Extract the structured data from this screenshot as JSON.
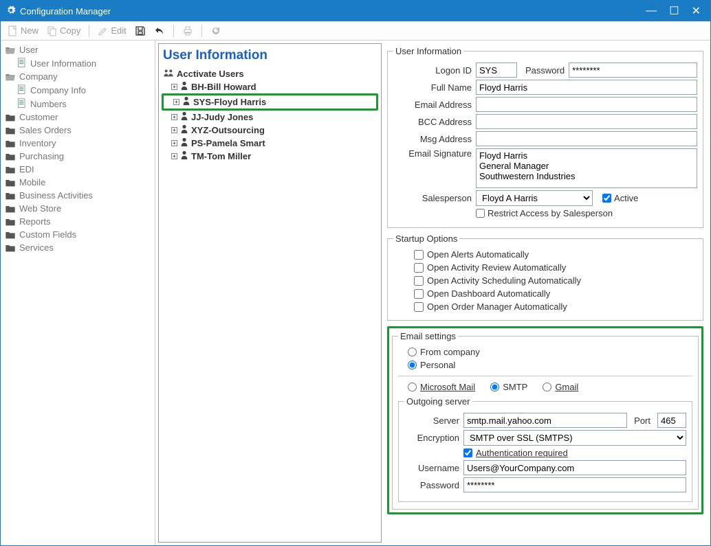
{
  "window": {
    "title": "Configuration Manager"
  },
  "toolbar": {
    "new": "New",
    "copy": "Copy",
    "edit": "Edit"
  },
  "sidebar": [
    {
      "label": "User",
      "type": "folder-open",
      "indent": 0,
      "children": [
        {
          "label": "User Information",
          "type": "doc",
          "indent": 1
        }
      ]
    },
    {
      "label": "Company",
      "type": "folder-open",
      "indent": 0,
      "children": [
        {
          "label": "Company Info",
          "type": "doc",
          "indent": 1
        },
        {
          "label": "Numbers",
          "type": "doc",
          "indent": 1
        }
      ]
    },
    {
      "label": "Customer",
      "type": "folder",
      "indent": 0
    },
    {
      "label": "Sales Orders",
      "type": "folder",
      "indent": 0
    },
    {
      "label": "Inventory",
      "type": "folder",
      "indent": 0
    },
    {
      "label": "Purchasing",
      "type": "folder",
      "indent": 0
    },
    {
      "label": "EDI",
      "type": "folder",
      "indent": 0
    },
    {
      "label": "Mobile",
      "type": "folder",
      "indent": 0
    },
    {
      "label": "Business Activities",
      "type": "folder",
      "indent": 0
    },
    {
      "label": "Web Store",
      "type": "folder",
      "indent": 0
    },
    {
      "label": "Reports",
      "type": "folder",
      "indent": 0
    },
    {
      "label": "Custom Fields",
      "type": "folder",
      "indent": 0
    },
    {
      "label": "Services",
      "type": "folder",
      "indent": 0
    }
  ],
  "panel_title": "User Information",
  "tree_header": "Acctivate Users",
  "users": [
    {
      "label": "BH-Bill Howard",
      "selected": false
    },
    {
      "label": "SYS-Floyd Harris",
      "selected": true
    },
    {
      "label": "JJ-Judy Jones",
      "selected": false
    },
    {
      "label": "XYZ-Outsourcing",
      "selected": false
    },
    {
      "label": "PS-Pamela Smart",
      "selected": false
    },
    {
      "label": "TM-Tom Miller",
      "selected": false
    }
  ],
  "userinfo": {
    "legend": "User Information",
    "labels": {
      "logon_id": "Logon ID",
      "password": "Password",
      "full_name": "Full Name",
      "email_address": "Email Address",
      "bcc_address": "BCC Address",
      "msg_address": "Msg Address",
      "email_signature": "Email Signature",
      "salesperson": "Salesperson",
      "active": "Active",
      "restrict": "Restrict Access by Salesperson"
    },
    "values": {
      "logon_id": "SYS",
      "password": "********",
      "full_name": "Floyd Harris",
      "email_address": "",
      "bcc_address": "",
      "msg_address": "",
      "email_signature": "Floyd Harris\nGeneral Manager\nSouthwestern Industries",
      "salesperson": "Floyd A Harris",
      "active": true,
      "restrict": false
    }
  },
  "startup": {
    "legend": "Startup Options",
    "items": [
      {
        "label": "Open Alerts Automatically",
        "checked": false
      },
      {
        "label": "Open Activity Review Automatically",
        "checked": false
      },
      {
        "label": "Open Activity Scheduling Automatically",
        "checked": false
      },
      {
        "label": "Open Dashboard Automatically",
        "checked": false
      },
      {
        "label": "Open Order Manager Automatically",
        "checked": false
      }
    ]
  },
  "email": {
    "legend": "Email settings",
    "source_from_company": "From company",
    "source_personal": "Personal",
    "source_selected": "personal",
    "proto_ms": "Microsoft Mail",
    "proto_smtp": "SMTP",
    "proto_gmail": "Gmail",
    "proto_selected": "smtp",
    "outgoing_legend": "Outgoing server",
    "labels": {
      "server": "Server",
      "port": "Port",
      "encryption": "Encryption",
      "auth_required": "Authentication required",
      "username": "Username",
      "password": "Password"
    },
    "values": {
      "server": "smtp.mail.yahoo.com",
      "port": "465",
      "encryption": "SMTP over SSL (SMTPS)",
      "auth_required": true,
      "username": "Users@YourCompany.com",
      "password": "********"
    }
  }
}
